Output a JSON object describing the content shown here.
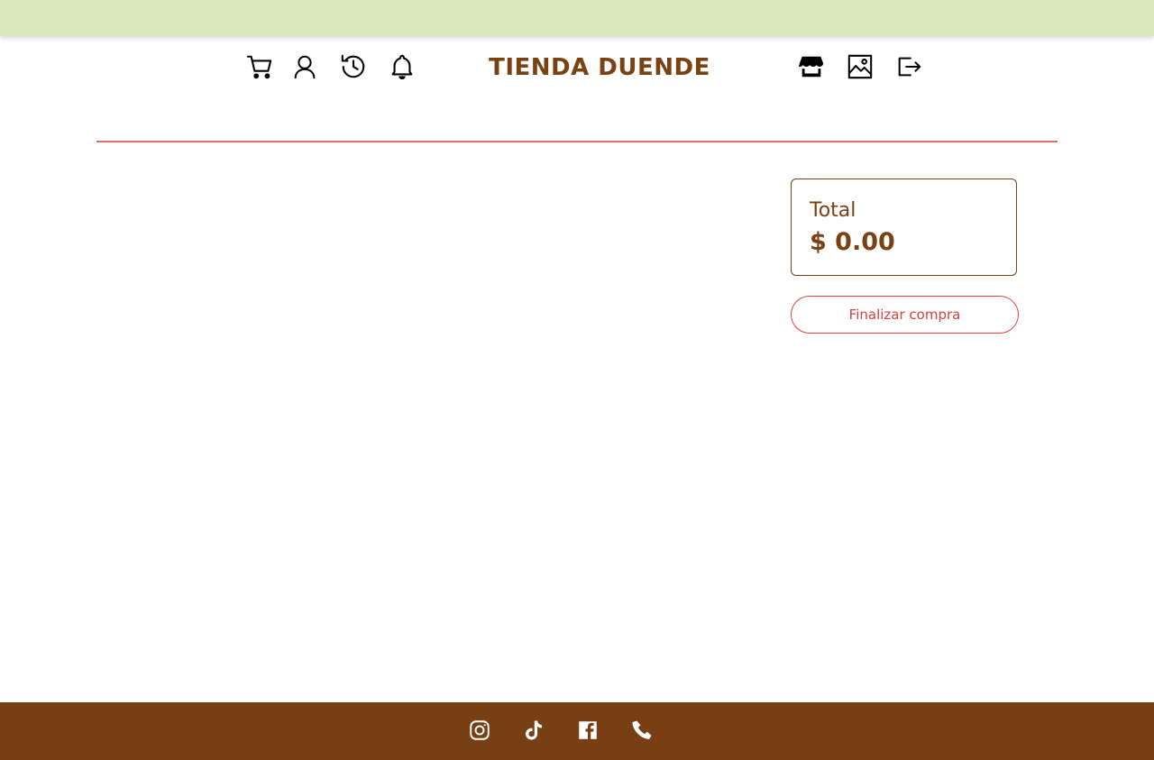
{
  "header": {
    "brand": "TIENDA DUENDE",
    "left_icons": [
      "cart-icon",
      "user-icon",
      "history-icon",
      "bell-icon"
    ],
    "right_icons": [
      "store-icon",
      "gallery-icon",
      "logout-icon"
    ]
  },
  "summary": {
    "total_label": "Total",
    "total_value": "$ 0.00",
    "checkout_label": "Finalizar compra"
  },
  "footer": {
    "social_icons": [
      "instagram-icon",
      "tiktok-icon",
      "facebook-icon",
      "phone-icon"
    ]
  },
  "colors": {
    "topbar": "#d9e9bb",
    "brand": "#7a4113",
    "divider": "#e26f66",
    "accent_red": "#e2453e",
    "footer": "#773f13"
  }
}
